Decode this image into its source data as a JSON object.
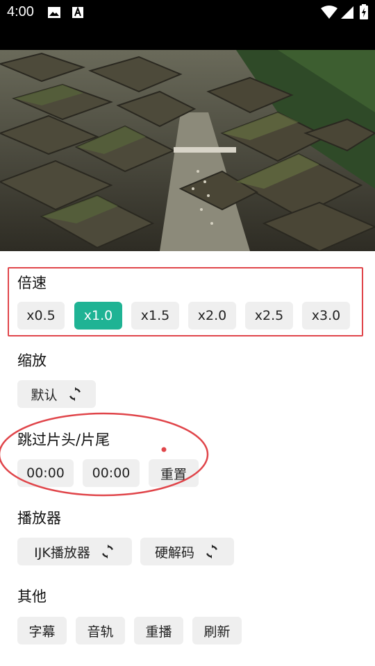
{
  "status_bar": {
    "time": "4:00",
    "icons": [
      "image-icon",
      "text-a-icon",
      "wifi-icon",
      "signal-icon",
      "battery-charging-icon"
    ]
  },
  "video": {
    "description_icon": "video-frame"
  },
  "sections": {
    "speed": {
      "title": "倍速",
      "options": [
        "x0.5",
        "x1.0",
        "x1.5",
        "x2.0",
        "x2.5",
        "x3.0"
      ],
      "selected": "x1.0"
    },
    "scale": {
      "title": "缩放",
      "value": "默认"
    },
    "skip": {
      "title": "跳过片头/片尾",
      "intro": "00:00",
      "outro": "00:00",
      "reset": "重置"
    },
    "player": {
      "title": "播放器",
      "engine": "IJK播放器",
      "decoder": "硬解码"
    },
    "other": {
      "title": "其他",
      "items": [
        "字幕",
        "音轨",
        "重播",
        "刷新"
      ]
    }
  },
  "colors": {
    "accent": "#1fb394",
    "annotation": "#e0454a"
  }
}
